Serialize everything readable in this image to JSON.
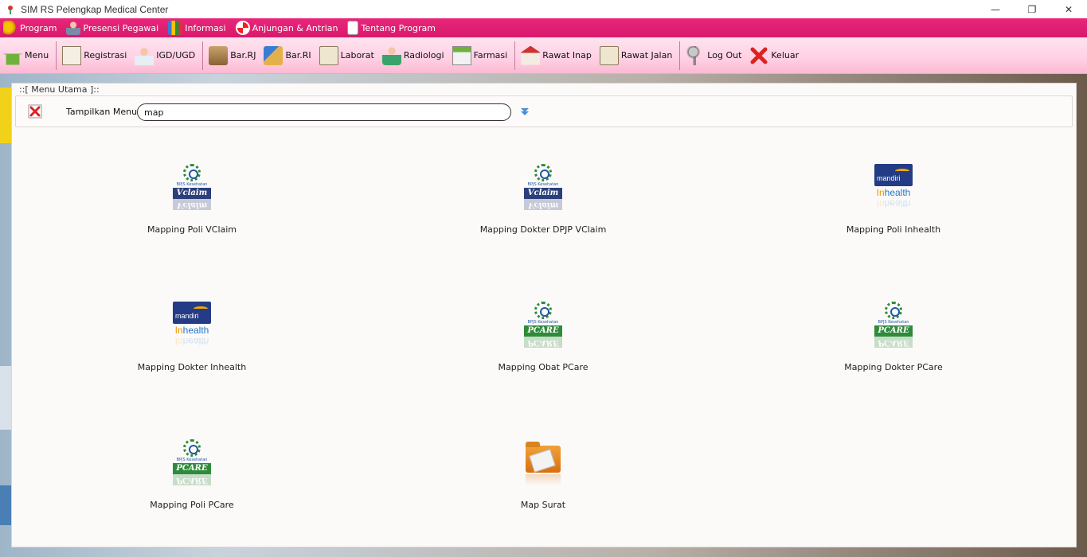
{
  "window": {
    "title": "SIM RS Pelengkap Medical Center",
    "controls": {
      "minimize": "—",
      "restore": "❐",
      "close": "✕"
    }
  },
  "menubar": {
    "items": [
      {
        "label": "Program",
        "icon": "key-icon"
      },
      {
        "label": "Presensi Pegawai",
        "icon": "person-icon"
      },
      {
        "label": "Informasi",
        "icon": "chart-icon"
      },
      {
        "label": "Anjungan & Antrian",
        "icon": "lifebuoy-icon"
      },
      {
        "label": "Tentang Program",
        "icon": "document-icon"
      }
    ]
  },
  "toolbar": {
    "items": [
      {
        "label": "Menu",
        "icon": "home-icon"
      },
      {
        "label": "Registrasi",
        "icon": "register-icon"
      },
      {
        "label": "IGD/UGD",
        "icon": "doctor-icon"
      },
      {
        "label": "Bar.RJ",
        "icon": "bar-rj-icon"
      },
      {
        "label": "Bar.RI",
        "icon": "bar-ri-icon"
      },
      {
        "label": "Laborat",
        "icon": "lab-icon"
      },
      {
        "label": "Radiologi",
        "icon": "radiology-icon"
      },
      {
        "label": "Farmasi",
        "icon": "pharmacy-icon"
      },
      {
        "label": "Rawat Inap",
        "icon": "hospital-icon"
      },
      {
        "label": "Rawat Jalan",
        "icon": "outpatient-icon"
      },
      {
        "label": "Log Out",
        "icon": "keys-icon"
      },
      {
        "label": "Keluar",
        "icon": "exit-x-icon"
      }
    ]
  },
  "panel": {
    "legend": "::[ Menu Utama ]::",
    "search_label": "Tampilkan Menu :",
    "search_value": "map"
  },
  "tiles": [
    {
      "label": "Mapping Poli VClaim",
      "logo": "bpjs-vclaim",
      "badge": "Vclaim"
    },
    {
      "label": "Mapping Dokter DPJP VClaim",
      "logo": "bpjs-vclaim",
      "badge": "Vclaim"
    },
    {
      "label": "Mapping Poli Inhealth",
      "logo": "mandiri-inhealth",
      "badge": "mandiri"
    },
    {
      "label": "Mapping Dokter Inhealth",
      "logo": "mandiri-inhealth",
      "badge": "mandiri"
    },
    {
      "label": "Mapping Obat PCare",
      "logo": "bpjs-pcare",
      "badge": "PCARE"
    },
    {
      "label": "Mapping Dokter PCare",
      "logo": "bpjs-pcare",
      "badge": "PCARE"
    },
    {
      "label": "Mapping Poli PCare",
      "logo": "bpjs-pcare",
      "badge": "PCARE"
    },
    {
      "label": "Map Surat",
      "logo": "folder",
      "badge": ""
    }
  ],
  "logo_text": {
    "bpjs": "BPJS Kesehatan",
    "inhealth_i": "In",
    "inhealth_rest": "health"
  },
  "colors": {
    "menubar": "#e8267a",
    "toolbar": "#ffd0e3",
    "bpjs_green": "#2e8b3a",
    "vclaim_navy": "#2b3f7a",
    "mandiri_navy": "#233c85"
  }
}
